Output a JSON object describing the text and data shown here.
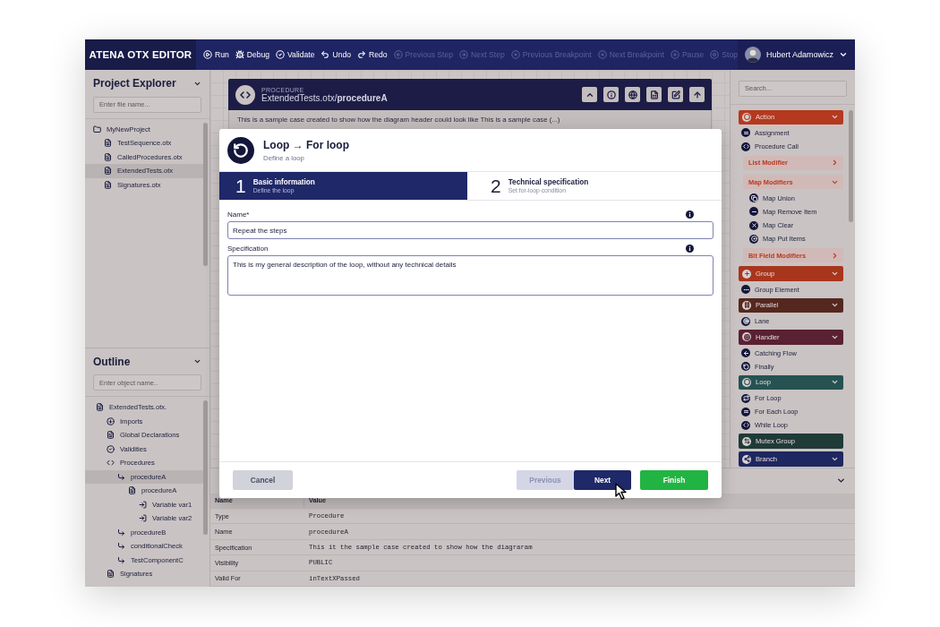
{
  "app": {
    "title": "ATENA OTX EDITOR"
  },
  "toolbar": [
    {
      "label": "Run",
      "disabled": false
    },
    {
      "label": "Debug",
      "disabled": false
    },
    {
      "label": "Validate",
      "disabled": false
    },
    {
      "label": "Undo",
      "disabled": false
    },
    {
      "label": "Redo",
      "disabled": false
    },
    {
      "label": "Previous Step",
      "disabled": true
    },
    {
      "label": "Next Step",
      "disabled": true
    },
    {
      "label": "Previous Breakpoint",
      "disabled": true
    },
    {
      "label": "Next Breakpoint",
      "disabled": true
    },
    {
      "label": "Pause",
      "disabled": true
    },
    {
      "label": "Stop",
      "disabled": true
    }
  ],
  "user": {
    "name": "Hubert Adamowicz"
  },
  "project_explorer": {
    "title": "Project Explorer",
    "placeholder": "Enter file name...",
    "tree": [
      {
        "label": "MyNewProject",
        "kind": "folder",
        "selected": false,
        "children": [
          {
            "label": "TestSequence.otx",
            "kind": "file",
            "selected": false
          },
          {
            "label": "CalledProcedures.otx",
            "kind": "file",
            "selected": false
          },
          {
            "label": "ExtendedTests.otx",
            "kind": "file",
            "selected": true
          },
          {
            "label": "Signatures.otx",
            "kind": "file",
            "selected": false
          }
        ]
      }
    ]
  },
  "outline": {
    "title": "Outline",
    "placeholder": "Enter object name..",
    "tree": [
      {
        "label": "ExtendedTests.otx.",
        "kind": "file",
        "selected": false,
        "children": [
          {
            "label": "Imports",
            "kind": "import",
            "selected": false
          },
          {
            "label": "Global Declarations",
            "kind": "file",
            "selected": false
          },
          {
            "label": "Validities",
            "kind": "check",
            "selected": false
          },
          {
            "label": "Procedures",
            "kind": "code",
            "selected": false,
            "children": [
              {
                "label": "procedureA",
                "kind": "procedure",
                "selected": true,
                "children": [
                  {
                    "label": "procedureA",
                    "kind": "file",
                    "selected": false,
                    "children": [
                      {
                        "label": "Variable var1",
                        "kind": "variable",
                        "selected": false
                      },
                      {
                        "label": "Variable var2",
                        "kind": "variable",
                        "selected": false
                      }
                    ]
                  }
                ]
              },
              {
                "label": "procedureB",
                "kind": "procedure",
                "selected": false
              },
              {
                "label": "conditionalCheck",
                "kind": "procedure",
                "selected": false
              },
              {
                "label": "TestComponentC",
                "kind": "procedure",
                "selected": false
              }
            ]
          },
          {
            "label": "Signatures",
            "kind": "file",
            "selected": false
          }
        ]
      }
    ]
  },
  "procedure_header": {
    "label": "PROCEDURE",
    "path": "ExtendedTests.otx/**procedureA**",
    "description": "This is a sample case created to show how the diagram header could look like This is a sample case (...)"
  },
  "dialog": {
    "title": "Loop → For loop",
    "subtitle": "Define a loop",
    "steps": [
      {
        "number": "1",
        "title": "Basic information",
        "subtitle": "Define the loop",
        "selected": true
      },
      {
        "number": "2",
        "title": "Technical specification",
        "subtitle": "Set for-loop condition",
        "selected": false
      }
    ],
    "fields": [
      {
        "label": "Name*",
        "value": "Repeat the steps",
        "kind": "input"
      },
      {
        "label": "Specification",
        "value": "This is my general description of the loop, without any technical details",
        "kind": "textarea"
      }
    ],
    "buttons": [
      {
        "label": "Cancel",
        "kind": "cancel",
        "disabled": false
      },
      {
        "label": "Previous",
        "kind": "previous",
        "disabled": true
      },
      {
        "label": "Next",
        "kind": "next",
        "disabled": false
      },
      {
        "label": "Finish",
        "kind": "finish",
        "disabled": false
      }
    ]
  },
  "palette": {
    "placeholder": "Search...",
    "groups": [
      {
        "label": "Action",
        "color": "#b5391f",
        "kind": "collapsible",
        "expanded": true,
        "children": [
          {
            "kind": "item",
            "label": "Assignment"
          },
          {
            "kind": "item",
            "label": "Procedure Call"
          },
          {
            "kind": "subgroup",
            "label": "List Modifier",
            "expanded": false
          },
          {
            "kind": "subgroup",
            "label": "Map Modifiers",
            "expanded": true,
            "children": [
              {
                "kind": "item",
                "label": "Map Union"
              },
              {
                "kind": "item",
                "label": "Map Remove Item"
              },
              {
                "kind": "item",
                "label": "Map Clear"
              },
              {
                "kind": "item",
                "label": "Map Put Items"
              }
            ]
          },
          {
            "kind": "subgroup",
            "label": "Bit Field Modifiers",
            "expanded": false
          }
        ]
      },
      {
        "label": "Group",
        "color": "#a8361d",
        "kind": "collapsible",
        "expanded": true,
        "children": [
          {
            "kind": "item",
            "label": "Group Element"
          }
        ]
      },
      {
        "label": "Parallel",
        "color": "#55281f",
        "kind": "collapsible",
        "expanded": true,
        "children": [
          {
            "kind": "item",
            "label": "Lane"
          }
        ]
      },
      {
        "label": "Handler",
        "color": "#5a2033",
        "kind": "collapsible",
        "expanded": true,
        "children": [
          {
            "kind": "item",
            "label": "Catching Flow"
          },
          {
            "kind": "item",
            "label": "Finally"
          }
        ]
      },
      {
        "label": "Loop",
        "color": "#265252",
        "kind": "collapsible",
        "expanded": true,
        "children": [
          {
            "kind": "item",
            "label": "For Loop"
          },
          {
            "kind": "item",
            "label": "For Each Loop"
          },
          {
            "kind": "item",
            "label": "While Loop"
          }
        ]
      },
      {
        "label": "Mutex Group",
        "color": "#1f3b38",
        "kind": "single"
      },
      {
        "label": "Branch",
        "color": "#1f2760",
        "kind": "collapsible",
        "expanded": true
      }
    ]
  },
  "properties": {
    "columns": [
      "Name",
      "Value"
    ],
    "rows": [
      [
        "Type",
        "Procedure"
      ],
      [
        "Name",
        "procedureA"
      ],
      [
        "Specification",
        "This it the sample case created to show how the diagraram"
      ],
      [
        "Visibility",
        "PUBLIC"
      ],
      [
        "Valid For",
        "inTextXPassed"
      ]
    ]
  }
}
